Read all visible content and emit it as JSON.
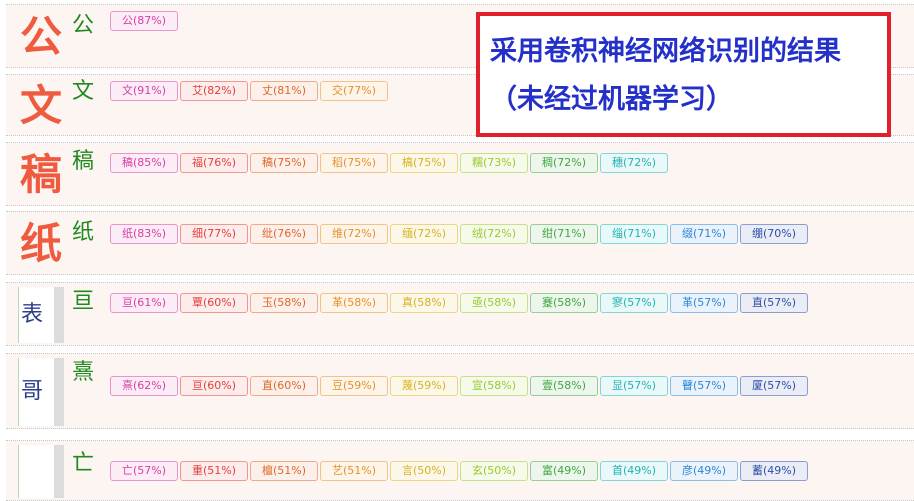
{
  "note": "采用卷积神经网络识别的结果（未经过机器学习）",
  "colors": {
    "row_bg": "#fdf5f2",
    "char_green": "#1f8a1f",
    "note_border": "#e0202c",
    "note_text": "#2431c9",
    "tag_palette": [
      "#d63fa4",
      "#e2403c",
      "#e0672a",
      "#e8902a",
      "#d8b21f",
      "#9ac92c",
      "#3fa83f",
      "#1fb4b4",
      "#2c86d8",
      "#2c4fa8"
    ]
  },
  "rows": [
    {
      "thumb": "公",
      "thumb_style": "red",
      "char": "公",
      "candidates": [
        "公(87%)"
      ]
    },
    {
      "thumb": "文",
      "thumb_style": "red",
      "char": "文",
      "candidates": [
        "文(91%)",
        "艾(82%)",
        "丈(81%)",
        "交(77%)"
      ]
    },
    {
      "thumb": "稿",
      "thumb_style": "red",
      "char": "稿",
      "candidates": [
        "稿(85%)",
        "福(76%)",
        "稿(75%)",
        "稻(75%)",
        "槁(75%)",
        "糯(73%)",
        "稠(72%)",
        "穗(72%)"
      ]
    },
    {
      "thumb": "纸",
      "thumb_style": "red",
      "char": "纸",
      "candidates": [
        "纸(83%)",
        "细(77%)",
        "纰(76%)",
        "维(72%)",
        "缅(72%)",
        "绒(72%)",
        "绀(71%)",
        "缁(71%)",
        "缀(71%)",
        "绷(70%)"
      ]
    },
    {
      "thumb": "表",
      "thumb_style": "hand",
      "char": "亘",
      "candidates": [
        "亘(61%)",
        "覃(60%)",
        "玉(58%)",
        "革(58%)",
        "真(58%)",
        "亟(58%)",
        "蹇(58%)",
        "寥(57%)",
        "革(57%)",
        "直(57%)"
      ]
    },
    {
      "thumb": "哥",
      "thumb_style": "hand",
      "char": "熹",
      "candidates": [
        "熹(62%)",
        "亘(60%)",
        "直(60%)",
        "豆(59%)",
        "蔑(59%)",
        "宣(58%)",
        "壹(58%)",
        "显(57%)",
        "瞽(57%)",
        "厦(57%)"
      ]
    },
    {
      "thumb": "",
      "thumb_style": "hand",
      "char": "亡",
      "candidates": [
        "亡(57%)",
        "重(51%)",
        "檀(51%)",
        "艺(51%)",
        "言(50%)",
        "玄(50%)",
        "富(49%)",
        "首(49%)",
        "彦(49%)",
        "蓄(49%)"
      ]
    }
  ]
}
